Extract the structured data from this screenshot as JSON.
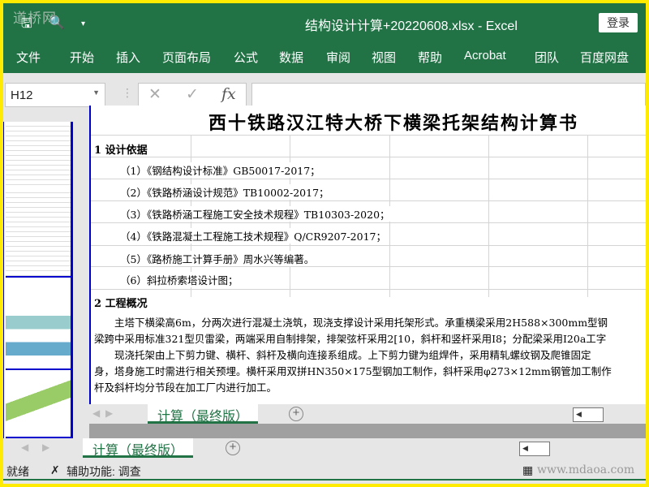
{
  "titlebar": {
    "watermark": "道桥网",
    "title": "结构设计计算+20220608.xlsx  -  Excel",
    "login": "登录"
  },
  "ribbon": {
    "tabs": [
      "文件",
      "开始",
      "插入",
      "页面布局",
      "公式",
      "数据",
      "审阅",
      "视图",
      "帮助",
      "Acrobat",
      "团队",
      "百度网盘"
    ]
  },
  "formula_bar": {
    "name_box": "H12",
    "cancel": "✕",
    "enter": "✓",
    "fx": "fx",
    "value": ""
  },
  "document": {
    "title": "西十铁路汉江特大桥下横梁托架结构计算书",
    "section1": "1 设计依据",
    "refs": [
      "（1）《钢结构设计标准》GB50017-2017；",
      "（2）《铁路桥涵设计规范》TB10002-2017；",
      "（3）《铁路桥涵工程施工安全技术规程》TB10303-2020；",
      "（4）《铁路混凝土工程施工技术规程》Q/CR9207-2017；",
      "（5）《路桥施工计算手册》周水兴等编著。",
      "（6）斜拉桥索塔设计图；"
    ],
    "section2": "2 工程概况",
    "para": [
      "　　主塔下横梁高6m，分两次进行混凝土浇筑，现浇支撑设计采用托架形式。承重横梁采用2H588×300mm型钢",
      "梁跨中采用标准321型贝雷梁，两端采用自制排架，排架弦杆采用2[10，斜杆和竖杆采用I8；分配梁采用I20a工字",
      "　　现浇托架由上下剪力键、横杆、斜杆及横向连接系组成。上下剪力键为组焊件，采用精轧螺纹钢及爬锥固定",
      "身，塔身施工时需进行相关预埋。横杆采用双拼HN350×175型钢加工制作，斜杆采用φ273×12mm钢管加工制作",
      "杆及斜杆均分节段在加工厂内进行加工。"
    ]
  },
  "sheet_tabs": {
    "active": "计算（最终版）"
  },
  "status": {
    "ready": "就绪",
    "accessibility": "辅助功能: 调查",
    "watermark": "www.mdaoa.com"
  }
}
